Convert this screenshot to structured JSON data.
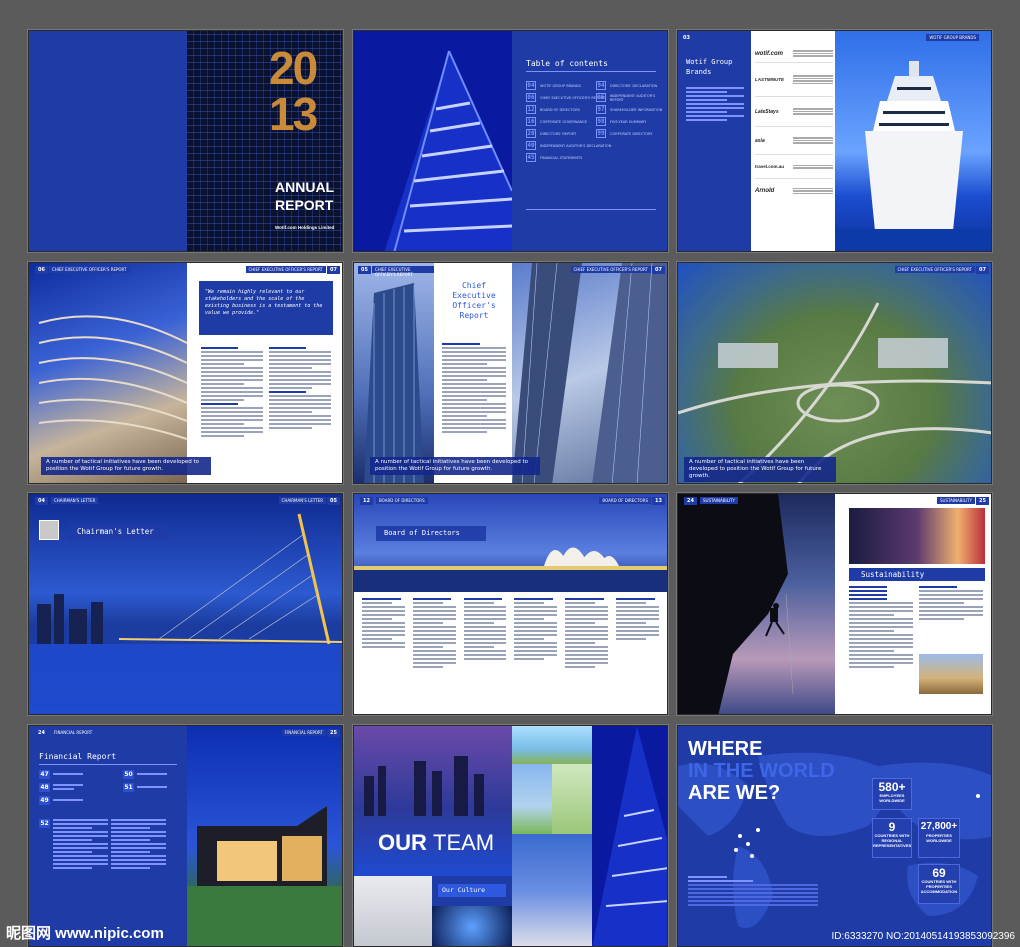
{
  "cover": {
    "year_top": "20",
    "year_bottom": "13",
    "annual": "ANNUAL",
    "report": "REPORT",
    "company": "Wotif.com Holdings Limited"
  },
  "toc": {
    "title": "Table of contents",
    "items": [
      {
        "num": "04",
        "label": "WOTIF GROUP BRANDS"
      },
      {
        "num": "06",
        "label": "CHIEF EXECUTIVE OFFICER'S REPORT"
      },
      {
        "num": "12",
        "label": "BOARD OF DIRECTORS"
      },
      {
        "num": "16",
        "label": "CORPORATE GOVERNANCE"
      },
      {
        "num": "20",
        "label": "DIRECTORS' REPORT"
      },
      {
        "num": "40",
        "label": "INDEPENDENT AUDITOR'S DECLARATION"
      },
      {
        "num": "45",
        "label": "FINANCIAL STATEMENTS"
      },
      {
        "num": "94",
        "label": "DIRECTORS' DECLARATION"
      },
      {
        "num": "95",
        "label": "INDEPENDENT AUDITOR'S REPORT"
      },
      {
        "num": "97",
        "label": "SHAREHOLDER INFORMATION"
      },
      {
        "num": "98",
        "label": "FIVE-YEAR SUMMARY"
      },
      {
        "num": "99",
        "label": "CORPORATE DIRECTORY"
      }
    ]
  },
  "brands": {
    "page": "03",
    "header": "WOTIF GROUP BRANDS",
    "title": "Wotif Group Brands",
    "logos": [
      "wotif.com",
      "LASTMINUTE",
      "LateStays",
      "asia",
      "travel.com.au",
      "Arnold"
    ]
  },
  "spread4": {
    "page_left": "06",
    "header_left": "CHIEF EXECUTIVE OFFICER'S REPORT",
    "header_right": "CHIEF EXECUTIVE OFFICER'S REPORT",
    "page_right": "07",
    "quote": "\"We remain highly relevant to our stakeholders and the scale of the existing business is a testament to the value we provide.\"",
    "caption": "A number of tactical initiatives have been developed to position the Wotif Group for future growth."
  },
  "spread5": {
    "page_left": "05",
    "header_left": "CHIEF EXECUTIVE OFFICER'S REPORT",
    "header_right": "CHIEF EXECUTIVE OFFICER'S REPORT",
    "page_right": "07",
    "title": "Chief Executive Officer's Report",
    "caption": "A number of tactical initiatives have been developed to position the Wotif Group for future growth."
  },
  "spread6": {
    "header_right": "CHIEF EXECUTIVE OFFICER'S REPORT",
    "page_right": "07",
    "caption": "A number of tactical initiatives have been developed to position the Wotif Group for future growth."
  },
  "chairman": {
    "page_left": "04",
    "header_left": "CHAIRMAN'S LETTER",
    "header_right": "CHAIRMAN'S LETTER",
    "page_right": "05",
    "title": "Chairman's Letter"
  },
  "board": {
    "page_left": "12",
    "header_left": "BOARD OF DIRECTORS",
    "header_right": "BOARD OF DIRECTORS",
    "page_right": "13",
    "title": "Board of Directors"
  },
  "sustain": {
    "page_left": "24",
    "header_left": "SUSTAINABILITY",
    "header_right": "SUSTAINABILITY",
    "page_right": "25",
    "title": "Sustainability"
  },
  "financial": {
    "page_left": "24",
    "header_left": "FINANCIAL REPORT",
    "header_right": "FINANCIAL REPORT",
    "page_right": "25",
    "title": "Financial Report",
    "nums": [
      "47",
      "48",
      "49",
      "50",
      "51",
      "52"
    ]
  },
  "team": {
    "title_a": "OUR",
    "title_b": "TEAM",
    "culture": "Our Culture"
  },
  "where": {
    "line1": "WHERE",
    "line2": "IN THE WORLD",
    "line3": "ARE WE?",
    "stats": [
      {
        "value": "580+",
        "label": "EMPLOYEES WORLDWIDE"
      },
      {
        "value": "9",
        "label": "COUNTRIES WITH REGIONAL REPRESENTATIVES"
      },
      {
        "value": "27,800+",
        "label": "PROPERTIES WORLDWIDE"
      },
      {
        "value": "69",
        "label": "COUNTRIES WITH PROPERTIES ACCOMMODATION"
      }
    ]
  },
  "footer": {
    "site": "昵图网 www.nipic.com",
    "id": "ID:6333270 NO:20140514193853092396"
  }
}
